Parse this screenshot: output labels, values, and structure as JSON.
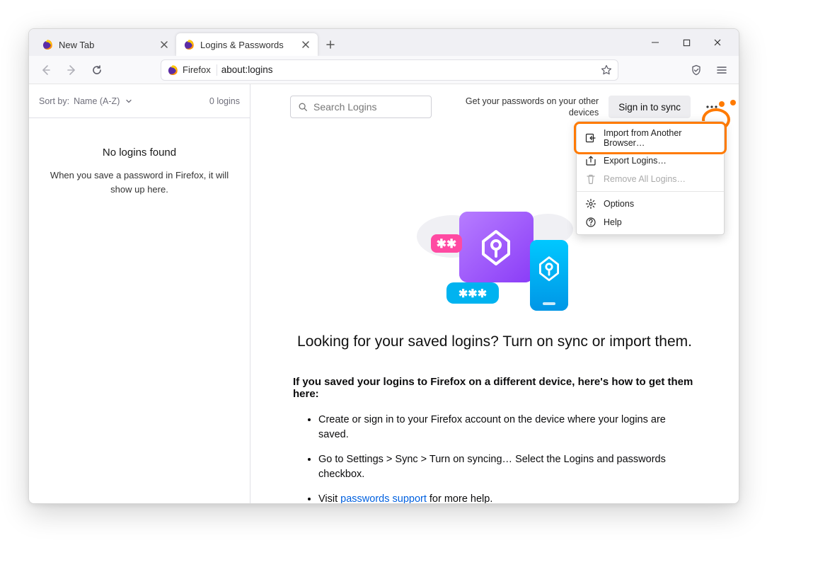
{
  "tabs": [
    {
      "label": "New Tab"
    },
    {
      "label": "Logins & Passwords"
    }
  ],
  "urlbar": {
    "identity": "Firefox",
    "url": "about:logins"
  },
  "sidebar": {
    "sort_label": "Sort by:",
    "sort_value": "Name (A-Z)",
    "count": "0 logins",
    "empty_title": "No logins found",
    "empty_text": "When you save a password in Firefox, it will show up here."
  },
  "topbar": {
    "search_placeholder": "Search Logins",
    "sync_hint": "Get your passwords on your other devices",
    "signin": "Sign in to sync"
  },
  "menu": {
    "import": "Import from Another Browser…",
    "export": "Export Logins…",
    "remove": "Remove All Logins…",
    "options": "Options",
    "help": "Help"
  },
  "main": {
    "headline": "Looking for your saved logins? Turn on sync or import them.",
    "lead": "If you saved your logins to Firefox on a different device, here's how to get them here:",
    "step1": "Create or sign in to your Firefox account on the device where your logins are saved.",
    "step2": "Go to Settings > Sync > Turn on syncing… Select the Logins and passwords checkbox.",
    "step3_pre": "Visit ",
    "step3_link": "passwords support",
    "step3_post": " for more help."
  }
}
